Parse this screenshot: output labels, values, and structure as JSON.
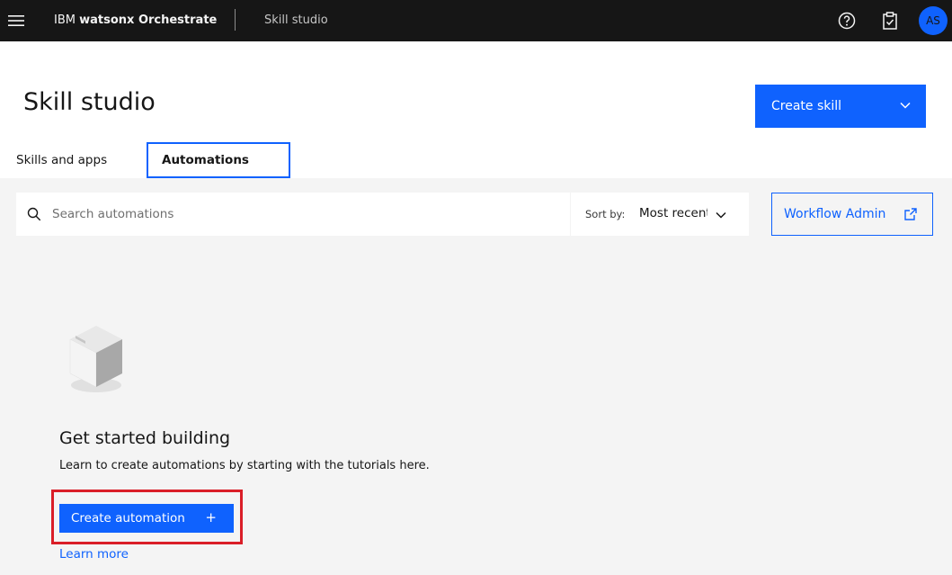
{
  "topbar": {
    "brand_ibm": "IBM",
    "brand_product": "watsonx Orchestrate",
    "breadcrumb": "Skill studio",
    "avatar_initials": "AS"
  },
  "header": {
    "title": "Skill studio",
    "create_skill_label": "Create skill"
  },
  "tabs": [
    {
      "label": "Skills and apps",
      "selected": false
    },
    {
      "label": "Automations",
      "selected": true
    }
  ],
  "toolbar": {
    "search_placeholder": "Search automations",
    "sort_label": "Sort by:",
    "sort_value": "Most recent",
    "workflow_admin_label": "Workflow Admin"
  },
  "empty_state": {
    "title": "Get started building",
    "description": "Learn to create automations by starting with the tutorials here.",
    "create_button_label": "Create automation",
    "create_button_icon": "+",
    "learn_more_label": "Learn more"
  },
  "colors": {
    "accent": "#0f62fe",
    "topbar": "#161616",
    "highlight": "#da1e28"
  }
}
